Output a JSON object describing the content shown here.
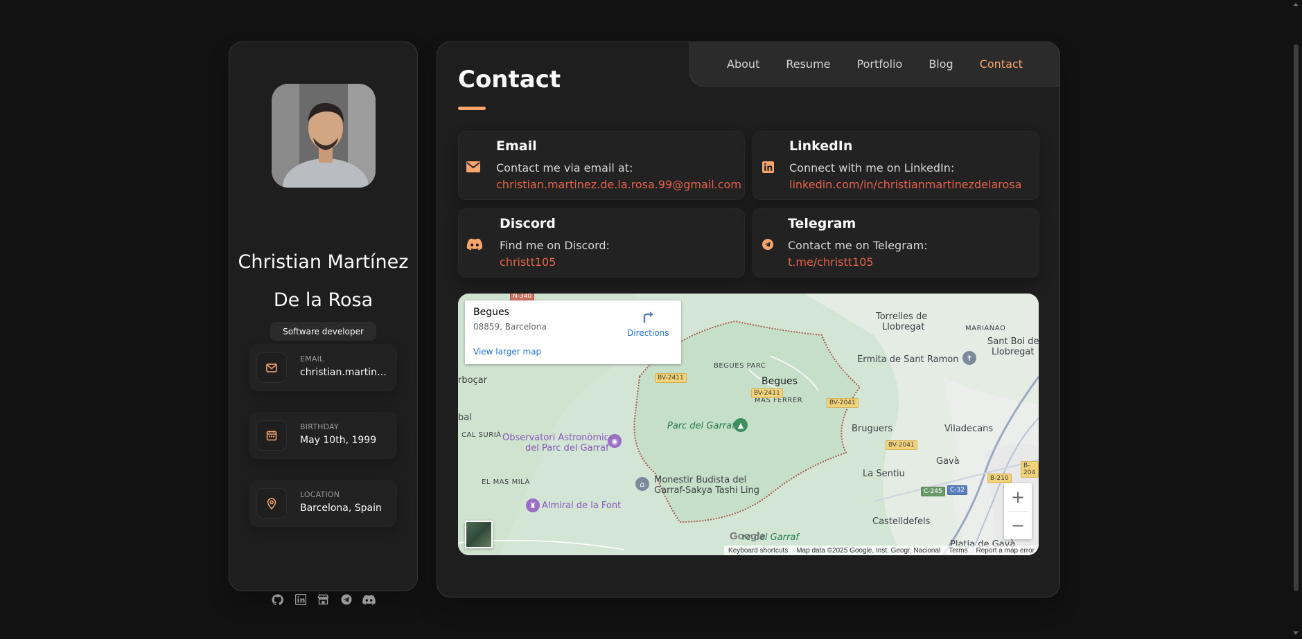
{
  "sidebar": {
    "name_line1": "Christian Martínez",
    "name_line2": "De la Rosa",
    "title": "Software developer",
    "contacts": [
      {
        "label": "EMAIL",
        "value": "christian.martinez.de.la.rosa.99@gmail.com",
        "icon": "mail-icon"
      },
      {
        "label": "BIRTHDAY",
        "value": "May 10th, 1999",
        "icon": "calendar-icon"
      },
      {
        "label": "LOCATION",
        "value": "Barcelona, Spain",
        "icon": "location-pin-icon"
      }
    ],
    "socials": [
      "github-icon",
      "linkedin-icon",
      "store-icon",
      "telegram-icon",
      "discord-icon"
    ]
  },
  "nav": {
    "links": [
      "About",
      "Resume",
      "Portfolio",
      "Blog",
      "Contact"
    ],
    "active": "Contact"
  },
  "page": {
    "title": "Contact"
  },
  "cards": {
    "email": {
      "title": "Email",
      "text": "Contact me via email at:",
      "link": "christian.martinez.de.la.rosa.99@gmail.com"
    },
    "linkedin": {
      "title": "LinkedIn",
      "text": "Connect with me on LinkedIn:",
      "link": "linkedin.com/in/christianmartinezdelarosa"
    },
    "discord": {
      "title": "Discord",
      "text": "Find me on Discord:",
      "link": "christt105"
    },
    "telegram": {
      "title": "Telegram",
      "text": "Contact me on Telegram:",
      "link": "t.me/christt105"
    }
  },
  "map": {
    "place_name": "Begues",
    "place_address": "08859, Barcelona",
    "directions_label": "Directions",
    "larger_map_label": "View larger map",
    "labels": {
      "torrelles": "Torrelles de",
      "torrelles2": "Llobregat",
      "marianao": "MARIANAO",
      "santboi": "Sant Boi de",
      "santboi2": "Llobregat",
      "ermita": "Ermita de Sant Ramon",
      "begues_parc": "BEGUES PARC",
      "begues": "Begues",
      "mas_ferrer": "MAS FERRER",
      "arboc": "rboçar",
      "bal": "bal",
      "cal_suria": "CAL SURIÀ",
      "observatori": "Observatori Astronòmic",
      "observatori2": "del Parc del Garraf",
      "parc_garraf": "Parc del Garraf",
      "bruguers": "Bruguers",
      "viladecans": "Viladecans",
      "gava": "Gavà",
      "la_sentiu": "La Sentiu",
      "el_mas_mila": "EL MAS MILÀ",
      "monestir": "Monestir Budista del",
      "monestir2": "Garraf-Sakya Tashi Ling",
      "almiral": "Almiral de la Font",
      "castelldefels": "Castelldefels",
      "parc_garraf_bottom": "rc del Garraf",
      "platja": "Platja de Gavà"
    },
    "roads": {
      "n340": "N-340",
      "bv2411a": "BV-2411",
      "bv2411b": "BV-2411",
      "bv2041a": "BV-2041",
      "bv2041b": "BV-2041",
      "b210": "B-210",
      "b204": "B-204",
      "c245": "C-245",
      "c32": "C-32"
    },
    "zoom_in": "+",
    "zoom_out": "−",
    "google": "Google",
    "attribution": [
      "Keyboard shortcuts",
      "Map data ©2025 Google, Inst. Geogr. Nacional",
      "Terms",
      "Report a map error"
    ]
  },
  "colors": {
    "accent": "#f9a66c",
    "link": "#e6634a",
    "background": "#121212",
    "panel": "#1e1e1f"
  }
}
